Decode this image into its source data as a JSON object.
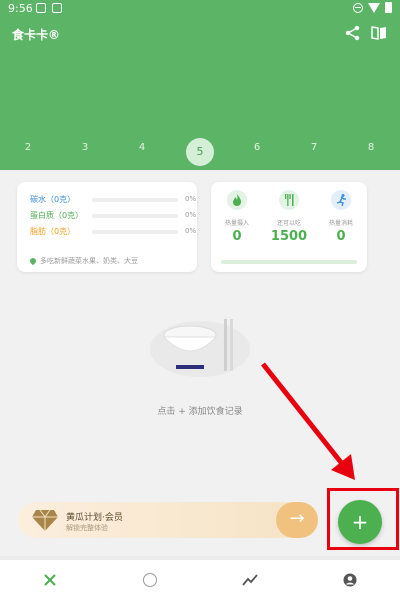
{
  "status": {
    "time": "9:56"
  },
  "app": {
    "title": "食卡卡®"
  },
  "week": {
    "days": [
      "2",
      "3",
      "4",
      "5",
      "6",
      "7",
      "8"
    ],
    "active_index": 3
  },
  "nutrition": {
    "rows": [
      {
        "label": "碳水（0克）",
        "pct": "0%",
        "color": "#3d8fe0",
        "fill": 0
      },
      {
        "label": "蛋白质（0克）",
        "pct": "0%",
        "color": "#4caf50",
        "fill": 0
      },
      {
        "label": "脂肪（0克）",
        "pct": "0%",
        "color": "#f0a020",
        "fill": 0
      }
    ],
    "tip": "多吃新鲜蔬菜水果、奶类、大豆"
  },
  "energy": {
    "cols": [
      {
        "label": "热量摄入",
        "value": "0",
        "icon": "flame-icon"
      },
      {
        "label": "还可以吃",
        "value": "1500",
        "icon": "cutlery-icon"
      },
      {
        "label": "热量消耗",
        "value": "0",
        "icon": "runner-icon"
      }
    ]
  },
  "empty": {
    "text": "点击 + 添加饮食记录"
  },
  "member": {
    "title": "黄瓜计划·会员",
    "subtitle": "解锁完整体验",
    "arrow": "→"
  },
  "fab": {
    "label": "+"
  },
  "colors": {
    "brand": "#5cb567",
    "accent": "#4caf50",
    "annotation": "#e8000f"
  }
}
